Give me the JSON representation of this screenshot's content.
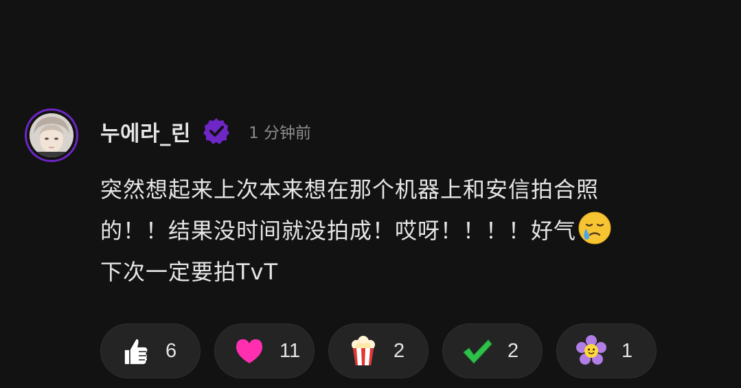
{
  "comment": {
    "author": "누에라_린",
    "verified_badge_icon": "verified-check-icon",
    "timestamp": "1 分钟前",
    "body_lines": [
      "突然想起来上次本来想在那个机器上和安信拍合照",
      "的！！结果没时间就没拍成！哎呀！！！！好气",
      "下次一定要拍TvT"
    ],
    "inline_emoji": "holding-back-tears-emoji",
    "accent_color": "#6f26c7"
  },
  "reactions": [
    {
      "icon": "thumbs-up-icon",
      "count": "6"
    },
    {
      "icon": "heart-icon",
      "count": "11"
    },
    {
      "icon": "popcorn-icon",
      "count": "2"
    },
    {
      "icon": "check-mark-icon",
      "count": "2"
    },
    {
      "icon": "flower-icon",
      "count": "1"
    }
  ]
}
